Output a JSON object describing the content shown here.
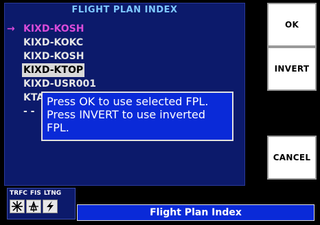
{
  "panel": {
    "title": "FLIGHT PLAN INDEX",
    "items": [
      {
        "label": "KIXD-KOSH",
        "arrow": "→"
      },
      {
        "label": "KIXD-KOKC"
      },
      {
        "label": "KIXD-KOSH"
      },
      {
        "label": "KIXD-KTOP"
      },
      {
        "label": "KIXD-USR001"
      },
      {
        "label": "KTA"
      },
      {
        "label": "- -"
      }
    ]
  },
  "dialog": {
    "line1": "Press OK to use selected FPL.",
    "line2": "Press INVERT to use inverted",
    "line3": "FPL."
  },
  "buttons": {
    "ok": "OK",
    "invert": "INVERT",
    "cancel": "CANCEL"
  },
  "status": {
    "trfc": "TRFC",
    "fis": "FIS",
    "ltng": "LTNG"
  },
  "page_title": "Flight Plan Index",
  "colors": {
    "panel_bg": "#0c1a6b",
    "title_text": "#7ec8ff",
    "active_item": "#d94bd9",
    "dialog_bg": "#0a2ad8",
    "button_bg": "#ffffff"
  },
  "icons": {
    "trfc": "traffic-icon",
    "fis": "weather-fis-icon",
    "ltng": "lightning-icon"
  }
}
